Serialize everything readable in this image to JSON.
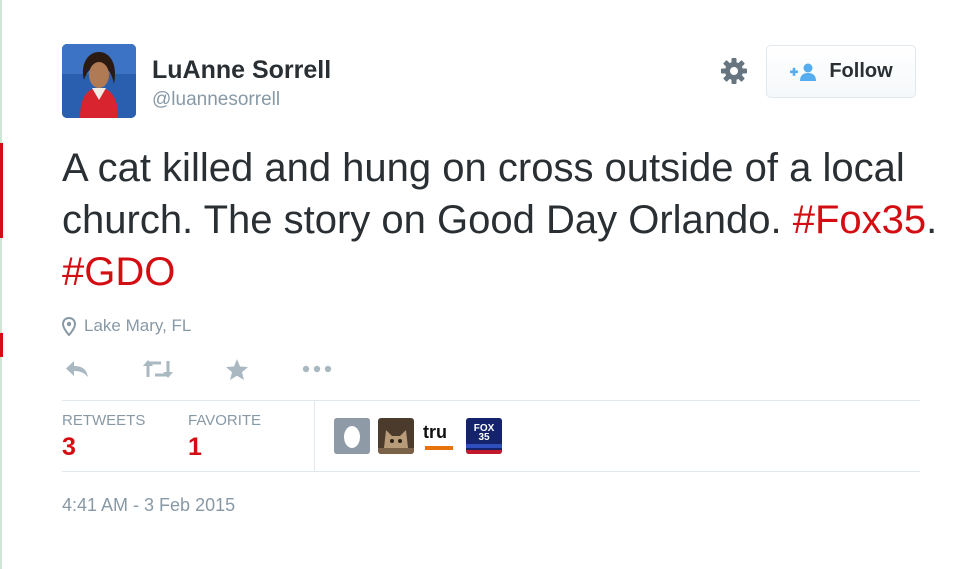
{
  "user": {
    "name": "LuAnne Sorrell",
    "handle": "@luannesorrell"
  },
  "header": {
    "follow_label": "Follow",
    "follow_icon": "follow-person-icon",
    "settings_icon": "gear-icon"
  },
  "tweet": {
    "text_main": "A cat killed and hung on cross outside of a local church.   The story on Good Day Orlando. ",
    "hashtag_1": "#Fox35",
    "separator": ". ",
    "hashtag_2": "#GDO"
  },
  "location": {
    "text": "Lake Mary, FL",
    "icon": "location-pin-icon"
  },
  "actions": [
    "reply-icon",
    "retweet-icon",
    "favorite-icon",
    "more-icon"
  ],
  "stats": {
    "retweets_label": "RETWEETS",
    "retweets_value": "3",
    "favorites_label": "FAVORITE",
    "favorites_value": "1"
  },
  "favoriters": [
    {
      "label": "",
      "kind": "egg"
    },
    {
      "label": "",
      "kind": "cat"
    },
    {
      "label": "tru",
      "kind": "tru"
    },
    {
      "label": "FOX 35",
      "kind": "fox35"
    }
  ],
  "timestamp": "4:41 AM - 3 Feb 2015",
  "colors": {
    "accent": "#d40d12",
    "text": "#292f33",
    "muted": "#8899a6",
    "divider": "#e1e8ed",
    "follow_icon": "#55acee"
  }
}
